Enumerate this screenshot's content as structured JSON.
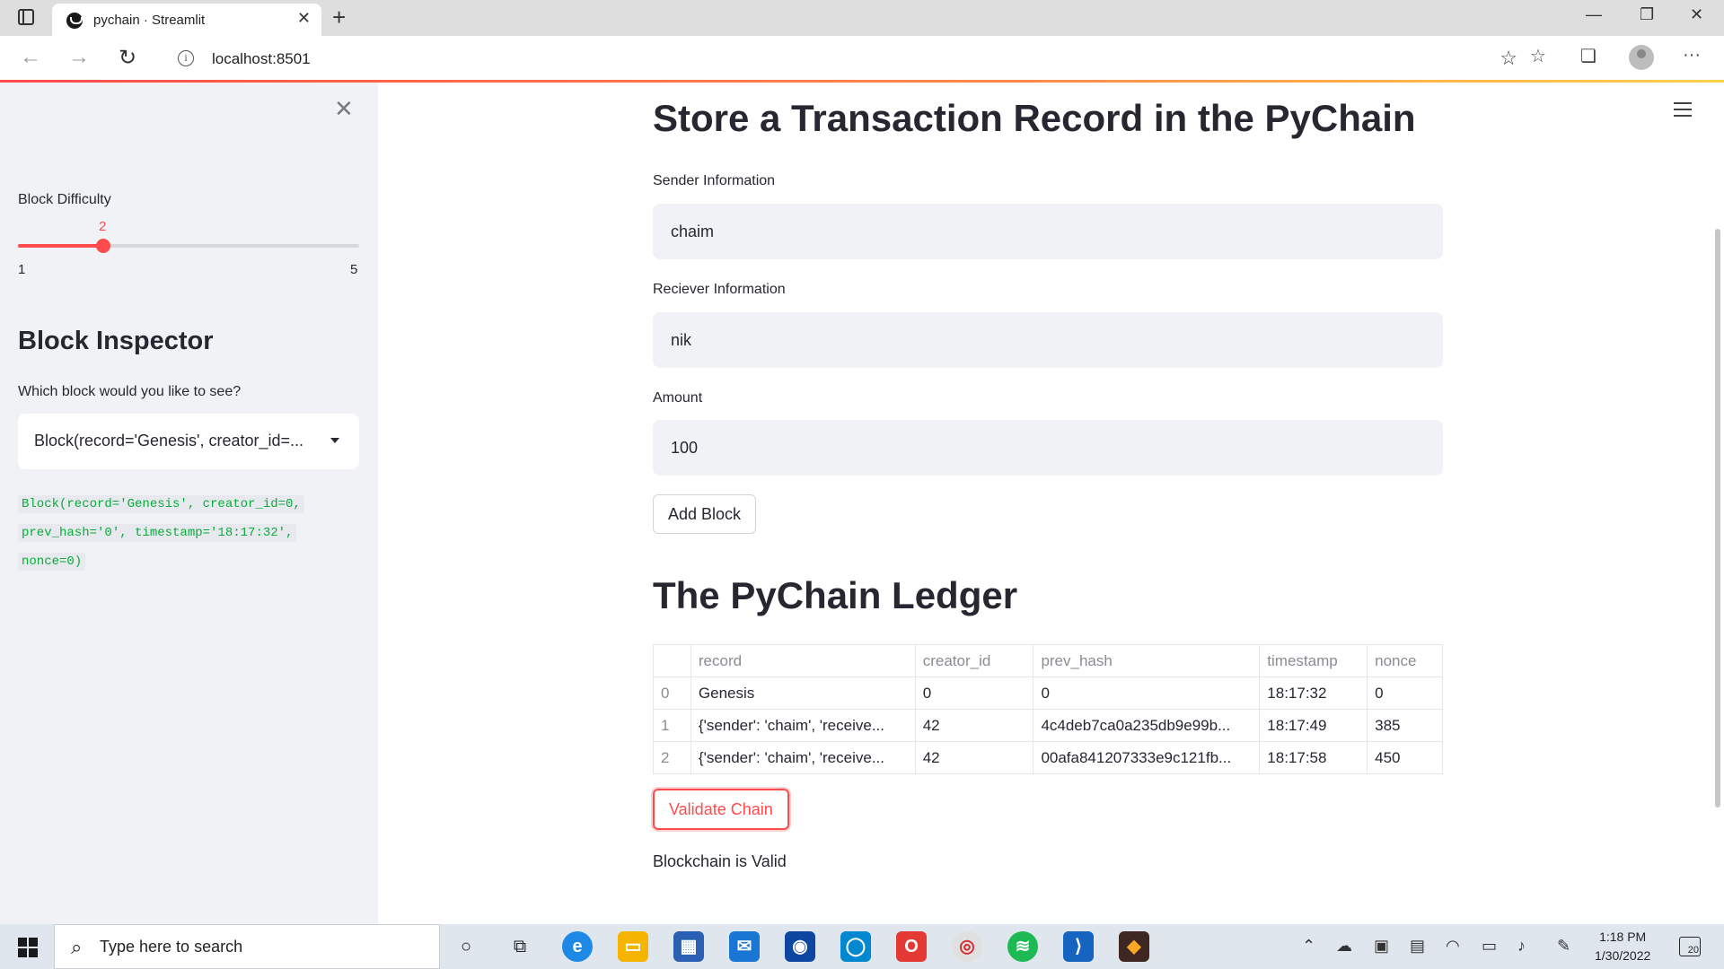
{
  "browser": {
    "tab_title": "pychain · Streamlit",
    "url": "localhost:8501"
  },
  "sidebar": {
    "slider": {
      "label": "Block Difficulty",
      "value": "2",
      "min": "1",
      "max": "5",
      "fraction": 0.25
    },
    "heading": "Block Inspector",
    "select_label": "Which block would you like to see?",
    "select_value": "Block(record='Genesis', creator_id=...",
    "code_lines": [
      "Block(record='Genesis', creator_id=0,",
      "prev_hash='0', timestamp='18:17:32',",
      "nonce=0)"
    ]
  },
  "main": {
    "title": "Store a Transaction Record in the PyChain",
    "sender": {
      "label": "Sender Information",
      "value": "chaim"
    },
    "receiver": {
      "label": "Reciever Information",
      "value": "nik"
    },
    "amount": {
      "label": "Amount",
      "value": "100"
    },
    "add_button": "Add Block",
    "ledger_title": "The PyChain Ledger",
    "table": {
      "columns": [
        "",
        "record",
        "creator_id",
        "prev_hash",
        "timestamp",
        "nonce"
      ],
      "rows": [
        [
          "0",
          "Genesis",
          "0",
          "0",
          "18:17:32",
          "0"
        ],
        [
          "1",
          "{'sender': 'chaim', 'receive...",
          "42",
          "4c4deb7ca0a235db9e99b...",
          "18:17:49",
          "385"
        ],
        [
          "2",
          "{'sender': 'chaim', 'receive...",
          "42",
          "00afa841207333e9c121fb...",
          "18:17:58",
          "450"
        ]
      ]
    },
    "validate_button": "Validate Chain",
    "status": "Blockchain is Valid"
  },
  "taskbar": {
    "search_placeholder": "Type here to search",
    "time": "1:18 PM",
    "date": "1/30/2022",
    "notifications": "20"
  },
  "colors": {
    "accent": "#ff4b4b",
    "sidebar_bg": "#f0f2f6",
    "code_green": "#09ab3b"
  }
}
